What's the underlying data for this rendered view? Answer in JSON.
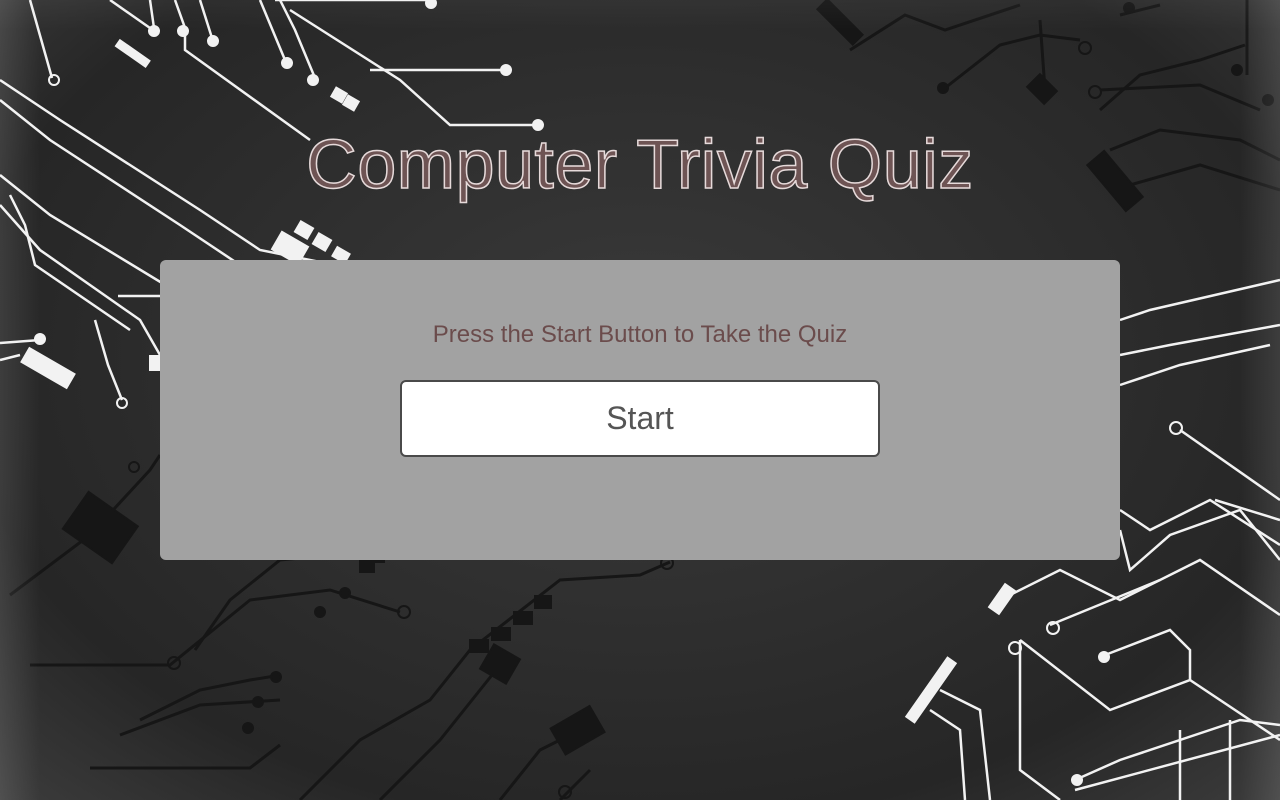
{
  "page": {
    "title": "Computer Trivia Quiz",
    "background_style": "dark circuit-board pattern"
  },
  "card": {
    "message": "Press the Start Button to Take the Quiz",
    "start_label": "Start"
  },
  "colors": {
    "title_fill": "#6e5454",
    "title_outline": "#e6dada",
    "card_background": "#a2a2a2",
    "message_text": "#6b4c4c",
    "button_background": "#ffffff",
    "button_text": "#555555",
    "page_background": "#2e2e2e"
  }
}
